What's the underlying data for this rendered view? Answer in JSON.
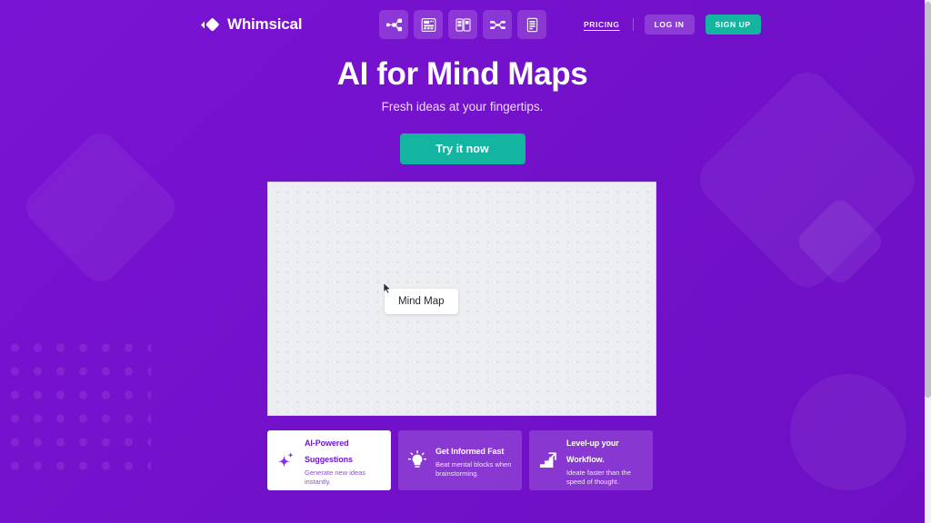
{
  "brand": {
    "name": "Whimsical",
    "logo_icon": "whimsical-diamond-logo"
  },
  "nav": {
    "tools": [
      {
        "icon": "mind-map-icon",
        "label": "Mind Map"
      },
      {
        "icon": "wireframe-icon",
        "label": "Wireframe"
      },
      {
        "icon": "board-icon",
        "label": "Board"
      },
      {
        "icon": "flowchart-icon",
        "label": "Flowchart"
      },
      {
        "icon": "document-icon",
        "label": "Doc"
      }
    ],
    "pricing_label": "PRICING",
    "login_label": "LOG IN",
    "signup_label": "SIGN UP"
  },
  "hero": {
    "title": "AI for Mind Maps",
    "subtitle": "Fresh ideas at your fingertips.",
    "cta_label": "Try it now"
  },
  "canvas": {
    "node_label": "Mind Map",
    "cursor_icon": "cursor-arrow-icon"
  },
  "cards": [
    {
      "icon": "sparkle-icon",
      "title": "AI-Powered Suggestions",
      "desc": "Generate new ideas instantly."
    },
    {
      "icon": "lightbulb-icon",
      "title": "Get Informed Fast",
      "desc": "Beat mental blocks when brainstorming."
    },
    {
      "icon": "stairs-arrow-icon",
      "title": "Level-up your Workflow.",
      "desc": "Ideate faster than the speed of thought."
    }
  ],
  "colors": {
    "background_purple": "#7613ce",
    "accent_teal": "#13b5a0",
    "card_purple_text": "#6d18c9",
    "white": "#ffffff"
  }
}
